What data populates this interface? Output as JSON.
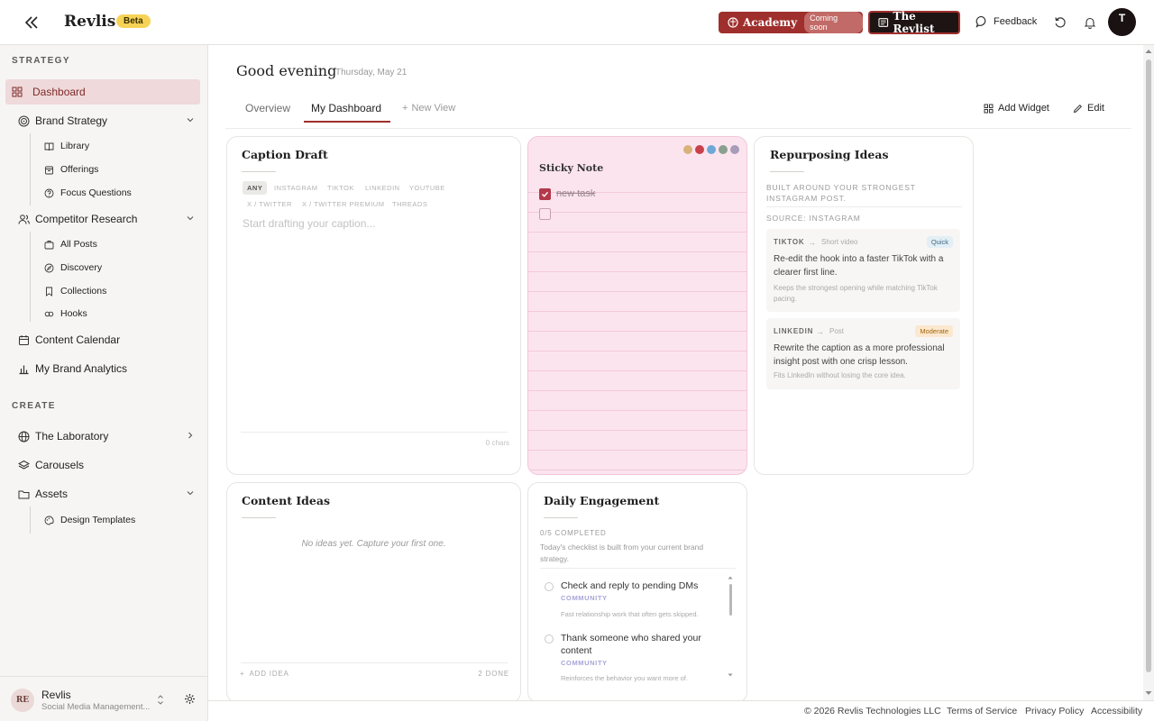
{
  "app": {
    "brand": "Revlis",
    "beta": "Beta",
    "academy_label": "Academy",
    "academy_badge": "Coming soon",
    "revlist_label": "The Revlist",
    "feedback_label": "Feedback",
    "user_initial": "T",
    "accent_color": "#9f2f2c"
  },
  "sidebar": {
    "strategy_title": "STRATEGY",
    "create_title": "CREATE",
    "dashboard": "Dashboard",
    "brand_strategy": "Brand Strategy",
    "library": "Library",
    "offerings": "Offerings",
    "focus_questions": "Focus Questions",
    "competitor_research": "Competitor Research",
    "all_posts": "All Posts",
    "discovery": "Discovery",
    "collections": "Collections",
    "hooks": "Hooks",
    "content_calendar": "Content Calendar",
    "brand_analytics": "My Brand Analytics",
    "laboratory": "The Laboratory",
    "carousels": "Carousels",
    "assets": "Assets",
    "design_templates": "Design Templates",
    "workspace_initials": "RE",
    "workspace_name": "Revlis",
    "workspace_sub": "Social Media Management..."
  },
  "header": {
    "greeting": "Good evening",
    "date": "Thursday, May 21",
    "tabs": [
      "Overview",
      "My Dashboard"
    ],
    "new_view": "New View",
    "add_widget": "Add Widget",
    "edit": "Edit"
  },
  "caption": {
    "title": "Caption Draft",
    "platforms": [
      "ANY",
      "INSTAGRAM",
      "TIKTOK",
      "LINKEDIN",
      "YOUTUBE",
      "X / TWITTER",
      "X / TWITTER PREMIUM",
      "THREADS"
    ],
    "placeholder": "Start drafting your caption...",
    "char_count": "0 chars"
  },
  "sticky": {
    "title": "Sticky Note",
    "colors": [
      "#d9b27a",
      "#c8404a",
      "#6fa7d9",
      "#8aa08f",
      "#a89cb8"
    ],
    "tasks": [
      {
        "text": "new task",
        "done": true
      },
      {
        "text": "",
        "done": false
      }
    ]
  },
  "repurposing": {
    "title": "Repurposing Ideas",
    "subtitle": "BUILT AROUND YOUR STRONGEST INSTAGRAM POST.",
    "source": "SOURCE: INSTAGRAM",
    "ideas": [
      {
        "platform": "TIKTOK",
        "format": "Short video",
        "badge": "Quick",
        "body": "Re-edit the hook into a faster TikTok with a clearer first line.",
        "note": "Keeps the strongest opening while matching TikTok pacing."
      },
      {
        "platform": "LINKEDIN",
        "format": "Post",
        "badge": "Moderate",
        "body": "Rewrite the caption as a more professional insight post with one crisp lesson.",
        "note": "Fits LinkedIn without losing the core idea."
      }
    ]
  },
  "content_ideas": {
    "title": "Content Ideas",
    "empty": "No ideas yet. Capture your first one.",
    "add": "ADD IDEA",
    "done": "2 DONE"
  },
  "engagement": {
    "title": "Daily Engagement",
    "progress": "0/5 COMPLETED",
    "desc": "Today's checklist is built from your current brand strategy.",
    "items": [
      {
        "text": "Check and reply to pending DMs",
        "category": "COMMUNITY",
        "note": "Fast relationship work that often gets skipped."
      },
      {
        "text": "Thank someone who shared your content",
        "category": "COMMUNITY",
        "note": "Reinforces the behavior you want more of."
      }
    ]
  },
  "footer": {
    "copyright": "© 2026 Revlis Technologies LLC",
    "terms": "Terms of Service",
    "privacy": "Privacy Policy",
    "accessibility": "Accessibility"
  }
}
